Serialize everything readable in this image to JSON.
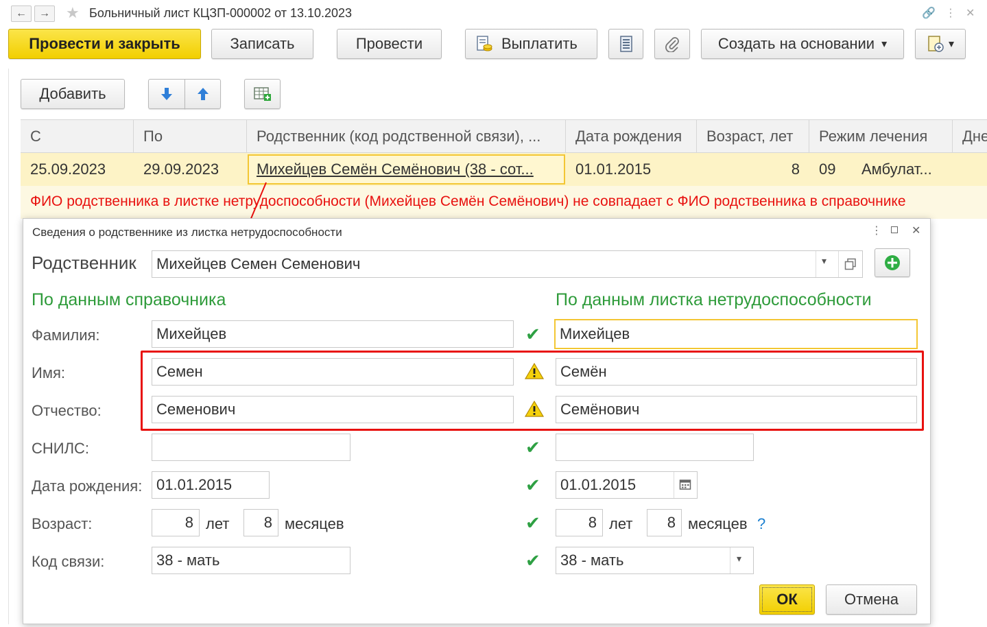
{
  "window": {
    "title": "Больничный лист КЦЗП-000002 от 13.10.2023",
    "back_icon": "←",
    "forward_icon": "→",
    "star_icon": "★",
    "link_icon": "🔗",
    "menu_icon": "⋮",
    "close_icon": "✕"
  },
  "toolbar": {
    "post_close": "Провести и закрыть",
    "save": "Записать",
    "post": "Провести",
    "pay": "Выплатить",
    "create_based": "Создать на основании",
    "dropdown_caret": "▾"
  },
  "table_toolbar": {
    "add": "Добавить"
  },
  "table": {
    "columns": [
      "С",
      "По",
      "Родственник (код родственной связи), ...",
      "Дата рождения",
      "Возраст, лет",
      "Режим лечения",
      "Дне"
    ],
    "row": {
      "from": "25.09.2023",
      "to": "29.09.2023",
      "relative": "Михейцев Семён Семёнович (38 - сот...",
      "birth_date": "01.01.2015",
      "age": "8",
      "mode_code": "09",
      "mode_name": "Амбулат..."
    },
    "error": "ФИО родственника в листке нетрудоспособности (Михейцев Семён Семёнович) не совпадает с ФИО родственника в справочнике"
  },
  "dialog": {
    "title": "Сведения о родственнике из листка нетрудоспособности",
    "relative_label": "Родственник",
    "relative_value": "Михейцев Семен Семенович",
    "left_header": "По данным справочника",
    "right_header": "По данным листка нетрудоспособности",
    "labels": {
      "last_name": "Фамилия:",
      "first_name": "Имя:",
      "patronymic": "Отчество:",
      "snils": "СНИЛС:",
      "birth_date": "Дата рождения:",
      "age": "Возраст:",
      "relation_code": "Код связи:"
    },
    "left": {
      "last_name": "Михейцев",
      "first_name": "Семен",
      "patronymic": "Семенович",
      "snils": "",
      "birth_date": "01.01.2015",
      "age_years": "8",
      "age_months": "8",
      "relation_code": "38 - мать"
    },
    "right": {
      "last_name": "Михейцев",
      "first_name": "Семён",
      "patronymic": "Семёнович",
      "snils": "",
      "birth_date": "01.01.2015",
      "age_years": "8",
      "age_months": "8",
      "relation_code": "38 - мать"
    },
    "years_label": "лет",
    "months_label": "месяцев",
    "question": "?",
    "check_mark": "✔",
    "warning_mark": "!",
    "ok": "ОК",
    "cancel": "Отмена"
  },
  "colors": {
    "accent_yellow": "#f2cf00",
    "error_red": "#e8110f",
    "ok_green": "#2e9b3a",
    "row_highlight": "#fdf3c6"
  }
}
